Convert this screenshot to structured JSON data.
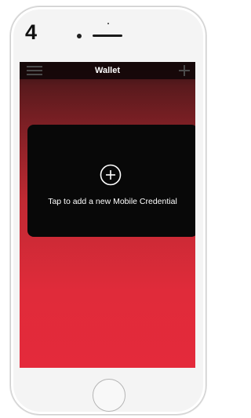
{
  "step_number": "4",
  "app": {
    "title": "Wallet"
  },
  "card": {
    "label": "Tap to add a new Mobile Credential",
    "icon": "plus-circle-icon"
  },
  "icons": {
    "menu": "hamburger-menu-icon",
    "add": "plus-icon"
  },
  "colors": {
    "background_top": "#2b1012",
    "background_bottom": "#e42a3b",
    "card": "#080808",
    "navbar": "#140809"
  }
}
